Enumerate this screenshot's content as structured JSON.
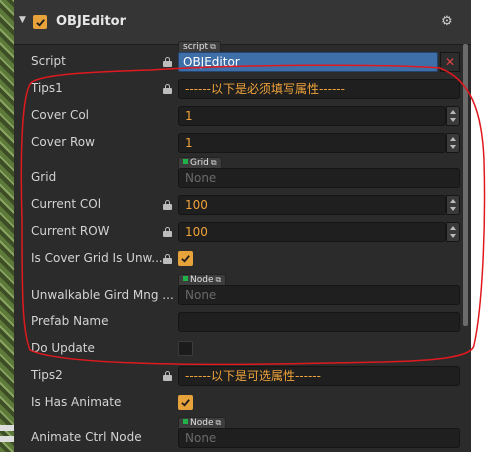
{
  "component": {
    "title": "OBJEditor"
  },
  "rows": {
    "script": {
      "label": "Script",
      "tag": "script",
      "value": "OBJEditor",
      "clear": "✕"
    },
    "tips1": {
      "label": "Tips1",
      "value": "------以下是必须填写属性------"
    },
    "cover_col": {
      "label": "Cover Col",
      "value": "1"
    },
    "cover_row": {
      "label": "Cover Row",
      "value": "1"
    },
    "grid": {
      "label": "Grid",
      "tag": "Grid",
      "value": "None"
    },
    "current_col": {
      "label": "Current COl",
      "value": "100"
    },
    "current_row": {
      "label": "Current ROW",
      "value": "100"
    },
    "is_cover_grid": {
      "label": "Is Cover Grid Is Unw...",
      "checked": true
    },
    "unwalkable": {
      "label": "Unwalkable Gird Mng ...",
      "tag": "Node",
      "value": "None"
    },
    "prefab_name": {
      "label": "Prefab Name",
      "value": ""
    },
    "do_update": {
      "label": "Do Update",
      "checked": false
    },
    "tips2": {
      "label": "Tips2",
      "value": "------以下是可选属性------"
    },
    "is_has_animate": {
      "label": "Is Has Animate",
      "checked": true
    },
    "animate_ctrl": {
      "label": "Animate Ctrl Node",
      "tag": "Node",
      "value": "None"
    }
  },
  "icons": {
    "settings": "gear-icon",
    "lock": "lock-icon",
    "link": "external-link-icon"
  },
  "colors": {
    "accent": "#e8a23a",
    "script_field": "#3f6fa8",
    "annotation": "#e0191f"
  }
}
